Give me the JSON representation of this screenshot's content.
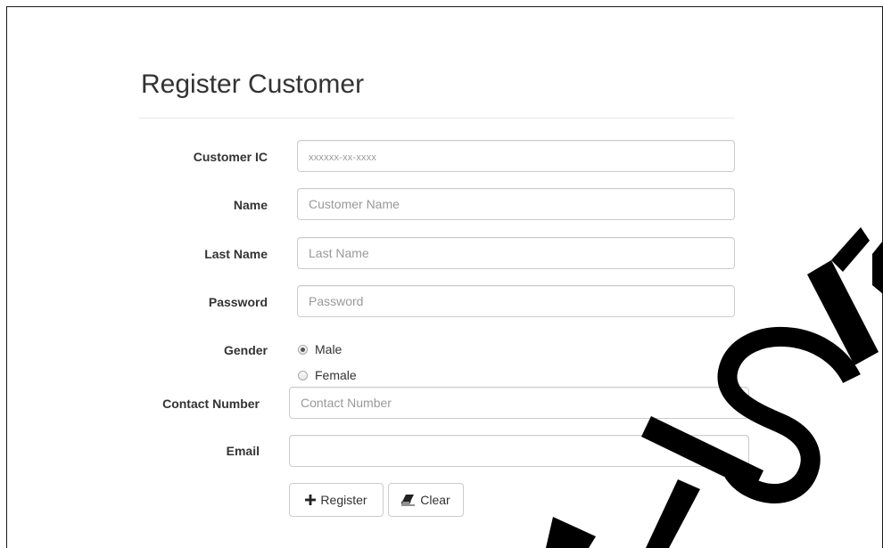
{
  "form": {
    "title": "Register Customer",
    "fields": {
      "customer_ic": {
        "label": "Customer IC",
        "placeholder": "xxxxxx-xx-xxxx",
        "value": ""
      },
      "name": {
        "label": "Name",
        "placeholder": "Customer Name",
        "value": ""
      },
      "last_name": {
        "label": "Last Name",
        "placeholder": "Last Name",
        "value": ""
      },
      "password": {
        "label": "Password",
        "placeholder": "Password",
        "value": ""
      },
      "contact_number": {
        "label": "Contact Number",
        "placeholder": "Contact Number",
        "value": ""
      },
      "email": {
        "label": "Email",
        "placeholder": "",
        "value": ""
      }
    },
    "gender": {
      "label": "Gender",
      "options": [
        {
          "label": "Male",
          "checked": true
        },
        {
          "label": "Female",
          "checked": false
        }
      ]
    },
    "buttons": {
      "register_label": "Register",
      "clear_label": "Clear"
    }
  },
  "watermark": {
    "text": "ETSM",
    "icon": "watermark-glyph"
  },
  "colors": {
    "text": "#333333",
    "border": "#cccccc",
    "placeholder": "#999999",
    "frame": "#1a1a1a"
  }
}
